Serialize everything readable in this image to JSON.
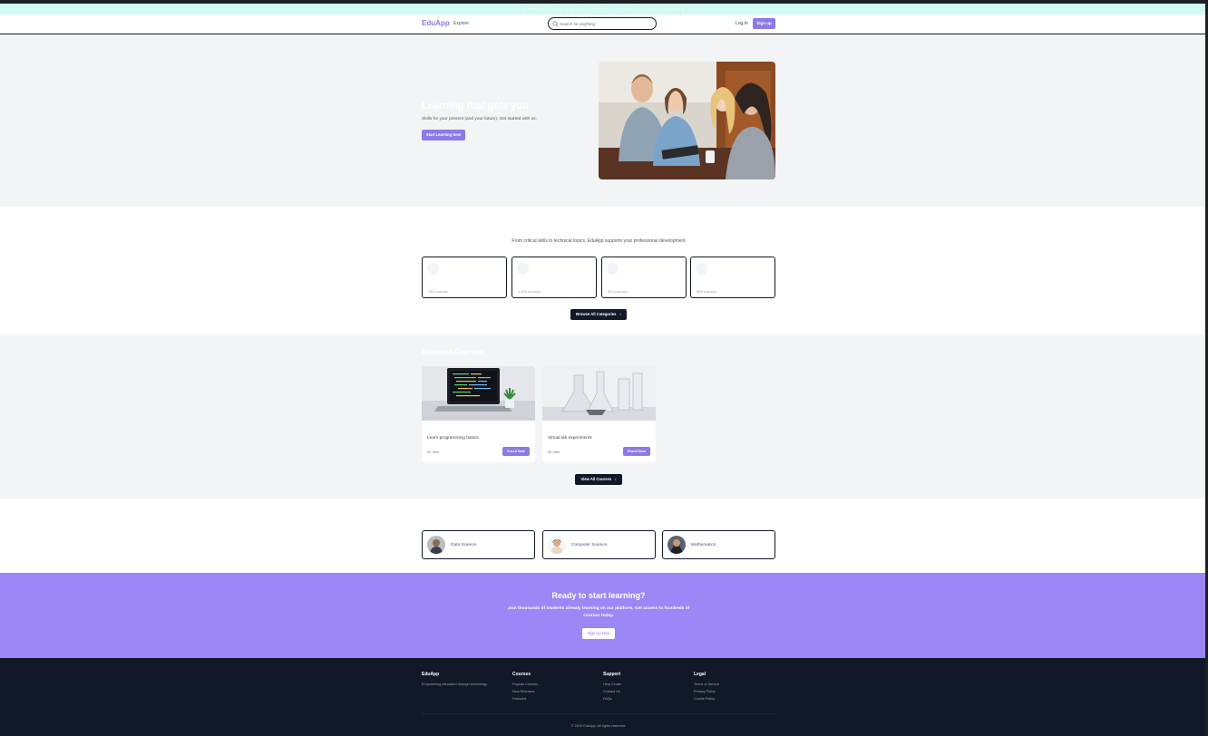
{
  "banner": {
    "text": "Get started with EduApp today! New courses added every week. Join now and start learning."
  },
  "nav": {
    "logo": "EduApp",
    "explore": "Explore",
    "search_placeholder": "Search for anything",
    "login": "Log in",
    "signup": "Sign up"
  },
  "hero": {
    "title": "Learning that gets you",
    "subtitle": "Skills for your present (and your future). Get started with us.",
    "button": "Start Learning Now"
  },
  "categories": {
    "intro": "From critical skills to technical topics, EduApp supports your professional development",
    "items": [
      {
        "count": "783 courses"
      },
      {
        "count": "1,104 courses"
      },
      {
        "count": "563 courses"
      },
      {
        "count": "986 courses"
      }
    ],
    "browse_button": "Browse All Categories"
  },
  "featured": {
    "title": "Featured Courses",
    "courses": [
      {
        "name": "Learn programming basics",
        "duration": "2h 30m",
        "button": "Enroll Now"
      },
      {
        "name": "Virtual lab experiments",
        "duration": "3h 45m",
        "button": "Enroll Now"
      }
    ],
    "view_all": "View All Courses"
  },
  "instructors": [
    {
      "name": "Data Science"
    },
    {
      "name": "Computer Science"
    },
    {
      "name": "Mathematics"
    }
  ],
  "cta": {
    "title": "Ready to start learning?",
    "subtitle": "Join thousands of students already learning on our platform. Get access to hundreds of courses today.",
    "button": "Sign Up Now"
  },
  "footer": {
    "brand": "EduApp",
    "tagline": "Empowering education through technology",
    "courses_head": "Courses",
    "courses_links": [
      "Popular Courses",
      "New Releases",
      "Featured"
    ],
    "support_head": "Support",
    "support_links": [
      "Help Center",
      "Contact Us",
      "FAQs"
    ],
    "legal_head": "Legal",
    "legal_links": [
      "Terms of Service",
      "Privacy Policy",
      "Cookie Policy"
    ],
    "copyright": "© 2019 EduApp. All rights reserved."
  },
  "colors": {
    "brand": "#8b7ae8",
    "cta_bg": "#9b87f5",
    "dark": "#111827",
    "banner": "#d1faf0"
  }
}
